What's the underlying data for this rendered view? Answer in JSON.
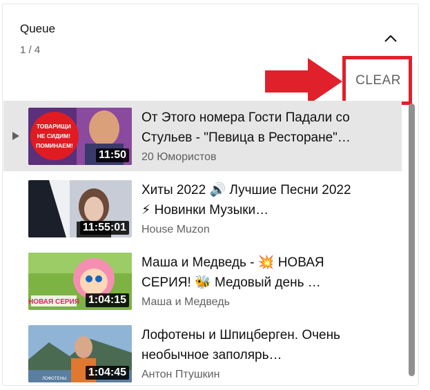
{
  "queue": {
    "title": "Queue",
    "counter": "1 / 4"
  },
  "clear_label": "CLEAR",
  "annotation_color": "#e0202a",
  "icons": {
    "collapse": "chevron-up-icon",
    "current": "play-triangle-icon"
  },
  "items": [
    {
      "title": "От Этого номера Гости Падали со Стульев - \"Певица в Ресторане\"…",
      "channel": "20 Юмористов",
      "duration": "11:50",
      "thumb_text": "ТОВАРИЩИ НЕ СИДИМ! ПОМИНАЕМ!"
    },
    {
      "title": "Хиты 2022 🔊 Лучшие Песни 2022 ⚡ Новинки Музыки…",
      "channel": "House Muzon",
      "duration": "11:55:01"
    },
    {
      "title": "Маша и Медведь - 💥 НОВАЯ СЕРИЯ! 🐝 Медовый день …",
      "channel": "Маша и Медведь",
      "duration": "1:04:15",
      "thumb_text": "НОВАЯ СЕРИЯ"
    },
    {
      "title": "Лофотены и Шпицберген. Очень необычное заполярь…",
      "channel": "Антон Птушкин",
      "duration": "1:04:45",
      "thumb_text": "ЛОФОТЕНЫ"
    }
  ]
}
